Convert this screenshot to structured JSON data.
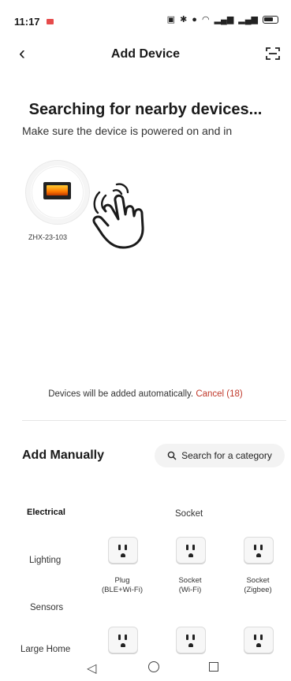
{
  "status_bar": {
    "time": "11:17"
  },
  "header": {
    "title": "Add Device"
  },
  "search": {
    "heading": "Searching for nearby devices...",
    "subtitle": "Make sure the device is powered on and in",
    "found_devices": [
      {
        "name": "ZHX-23-103"
      }
    ],
    "auto_add_text": "Devices will be added automatically.",
    "cancel_label": "Cancel (18)"
  },
  "manual": {
    "title": "Add Manually",
    "search_placeholder": "Search for a category",
    "categories": [
      "Electrical",
      "Lighting",
      "Sensors",
      "Large Home"
    ],
    "group_title": "Socket",
    "items": [
      {
        "line1": "Plug",
        "line2": "(BLE+Wi-Fi)"
      },
      {
        "line1": "Socket",
        "line2": "(Wi-Fi)"
      },
      {
        "line1": "Socket",
        "line2": "(Zigbee)"
      }
    ]
  },
  "colors": {
    "accent_red": "#c0392b"
  }
}
